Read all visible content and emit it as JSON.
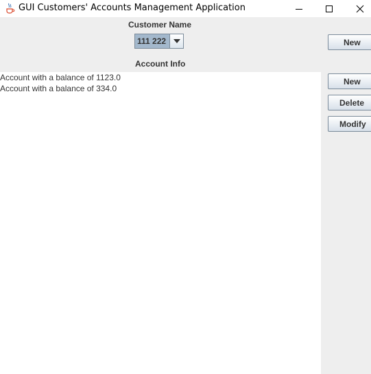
{
  "window": {
    "title": "GUI Customers' Accounts Management Application",
    "icon": "java-coffee-icon",
    "controls": [
      "minimize-icon",
      "maximize-icon",
      "close-icon"
    ]
  },
  "customer": {
    "label": "Customer Name",
    "selected": "111 222",
    "new_label": "New"
  },
  "accounts": {
    "label": "Account Info",
    "items": [
      "Account with a balance of 1123.0",
      "Account with a balance of 334.0"
    ],
    "new_label": "New",
    "delete_label": "Delete",
    "modify_label": "Modify"
  },
  "colors": {
    "accent_selection": "#a3b8cc",
    "panel_background": "#eeeeee",
    "list_background": "#ffffff"
  }
}
